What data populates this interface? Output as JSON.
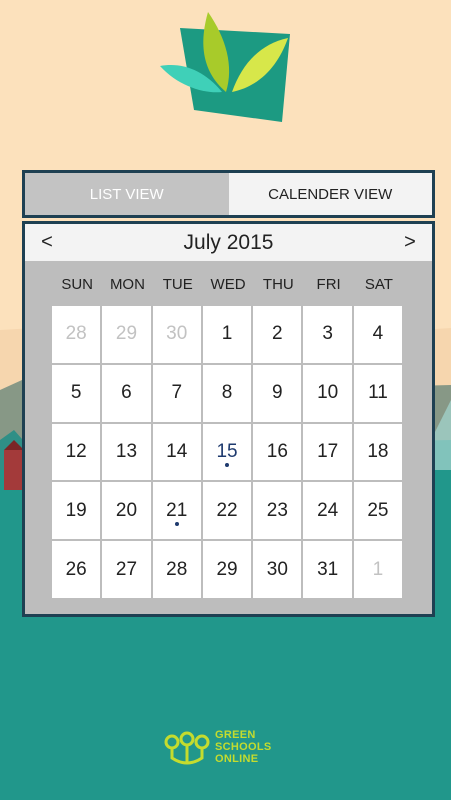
{
  "tabs": {
    "list_label": "LIST VIEW",
    "calendar_label": "CALENDER VIEW",
    "active": "calendar"
  },
  "calendar": {
    "month_title": "July 2015",
    "prev_label": "<",
    "next_label": ">",
    "weekdays": [
      "SUN",
      "MON",
      "TUE",
      "WED",
      "THU",
      "FRI",
      "SAT"
    ],
    "days": [
      {
        "label": "28",
        "muted": true
      },
      {
        "label": "29",
        "muted": true
      },
      {
        "label": "30",
        "muted": true
      },
      {
        "label": "1"
      },
      {
        "label": "2"
      },
      {
        "label": "3"
      },
      {
        "label": "4"
      },
      {
        "label": "5"
      },
      {
        "label": "6"
      },
      {
        "label": "7"
      },
      {
        "label": "8"
      },
      {
        "label": "9"
      },
      {
        "label": "10"
      },
      {
        "label": "11"
      },
      {
        "label": "12"
      },
      {
        "label": "13"
      },
      {
        "label": "14"
      },
      {
        "label": "15",
        "event": true,
        "highlight": true
      },
      {
        "label": "16"
      },
      {
        "label": "17"
      },
      {
        "label": "18"
      },
      {
        "label": "19"
      },
      {
        "label": "20"
      },
      {
        "label": "21",
        "event": true
      },
      {
        "label": "22"
      },
      {
        "label": "23"
      },
      {
        "label": "24"
      },
      {
        "label": "25"
      },
      {
        "label": "26"
      },
      {
        "label": "27"
      },
      {
        "label": "28"
      },
      {
        "label": "29"
      },
      {
        "label": "30"
      },
      {
        "label": "31"
      },
      {
        "label": "1",
        "muted": true
      }
    ]
  },
  "footer": {
    "line1": "GREEN",
    "line2": "SCHOOLS",
    "line3": "ONLINE"
  },
  "colors": {
    "background": "#FCE1BC",
    "teal": "#20958A",
    "navy": "#1E4052",
    "lime": "#C4DC2E",
    "event_dot": "#1E3A6E"
  }
}
